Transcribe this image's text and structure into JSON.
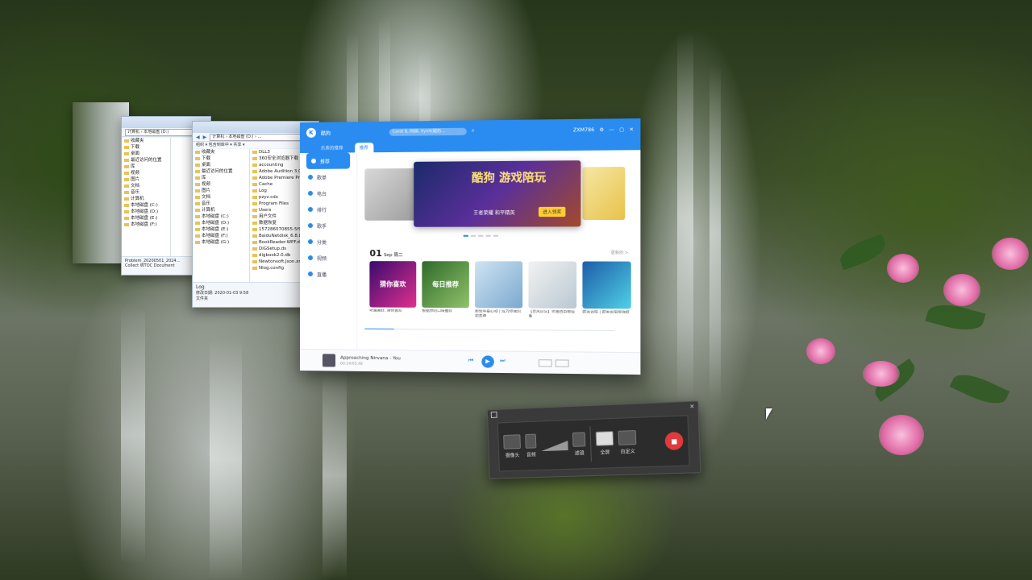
{
  "explorer_back": {
    "path": "计算机 › 本地磁盘 (D:)",
    "sidebar": [
      "收藏夹",
      "下载",
      "桌面",
      "最近访问的位置",
      "",
      "库",
      "视频",
      "图片",
      "文档",
      "音乐",
      "",
      "计算机",
      "本地磁盘 (C:)",
      "本地磁盘 (D:)",
      "本地磁盘 (E:)",
      "本地磁盘 (F:)"
    ],
    "status_line1": "Problem_20200501_2024...",
    "status_line2": "Collect WTOC Document"
  },
  "explorer_front": {
    "path": "计算机 › 本地磁盘 (D:) › ...",
    "toolbar": "组织 ▾   包含到库中 ▾   共享 ▾",
    "sidebar": [
      "收藏夹",
      "下载",
      "桌面",
      "最近访问的位置",
      "",
      "库",
      "视频",
      "图片",
      "文档",
      "音乐",
      "",
      "计算机",
      "本地磁盘 (C:)",
      "本地磁盘 (D:)",
      "本地磁盘 (E:)",
      "本地磁盘 (F:)",
      "本地磁盘 (G:)"
    ],
    "files": [
      "DLL3",
      "360安全浏览器下载",
      "accounting",
      "Adobe Audition 3.0",
      "Adobe Premiere Pro CC",
      "Cache",
      "Log",
      "pzyz.cdx",
      "Program Files",
      "Users",
      "用户文件",
      "数据恢复",
      "157286070855-5f9c5",
      "BaiduNetdisk_6.8.8.1",
      "BookReader-WPF.dll",
      "DiGSetup.ds",
      "digbook2.0.db",
      "Newtonsoft.Json.xml",
      "Nlog.config"
    ],
    "status_name": "Log",
    "status_detail": "修改日期: 2020-01-03 9:58",
    "status_type": "文件夹"
  },
  "kugou": {
    "logo": "K",
    "brand": "酷狗",
    "search_placeholder": "Cardi B, 阿肆, Vynlt(酸奶...",
    "user": "ZXM786",
    "tabs": [
      "乐库的推荐",
      "推荐"
    ],
    "nav": [
      "推荐",
      "歌单",
      "电台",
      "排行",
      "歌手",
      "分类",
      "视频",
      "直播"
    ],
    "banner_title": "酷狗 游戏陪玩",
    "banner_sub": "王者荣耀  和平精英",
    "banner_cta": "进入领奖",
    "date_day": "01",
    "date_month": "Sep",
    "date_weekday": "周二",
    "daily_more": "更新的 >",
    "cards": [
      {
        "title": "猜你喜欢",
        "caption": "听遍喜好, 猜你喜欢"
      },
      {
        "title": "每日推荐",
        "caption": "根据你的口味推荐"
      },
      {
        "title": "",
        "caption": "那些年最心动 | 成为你我的初恋神"
      },
      {
        "title": "",
        "caption": "【古风日记】听遍古韵那些事"
      },
      {
        "title": "",
        "caption": "欧美说唱 | 欧美说唱很嗨歌"
      }
    ],
    "song": "Approaching Nirvana - You",
    "time": "00:24/05:48",
    "progress": 0.12,
    "play_icon": "▶",
    "prev_icon": "⏮",
    "next_icon": "⏭"
  },
  "recorder": {
    "close": "✕",
    "camera_label": "摄像头",
    "mic_label": "音频",
    "system_label": "滤镜",
    "fullscreen_label": "全屏",
    "custom_label": "自定义",
    "record_icon": "■"
  },
  "colors": {
    "kugou_blue": "#2a8cf0",
    "record_red": "#e03a3a"
  }
}
